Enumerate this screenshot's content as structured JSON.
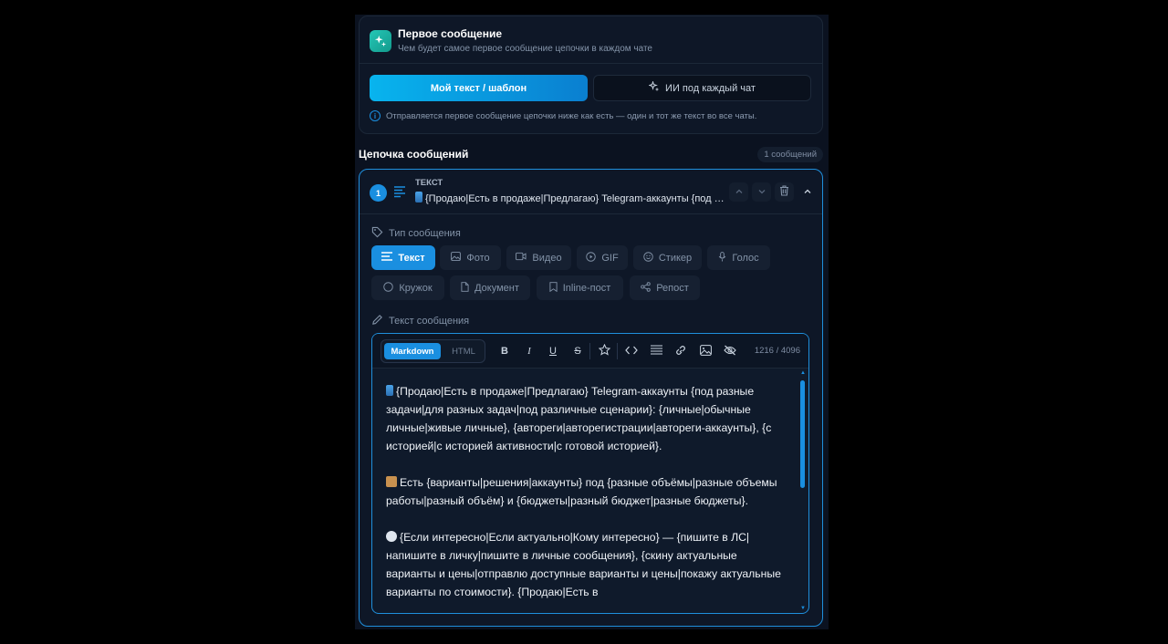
{
  "first_message": {
    "title": "Первое сообщение",
    "subtitle": "Чем будет самое первое сообщение цепочки в каждом чате",
    "mode_custom": "Мой текст / шаблон",
    "mode_ai": "ИИ под каждый чат",
    "info": "Отправляется первое сообщение цепочки ниже как есть — один и тот же текст во все чаты."
  },
  "chain": {
    "title": "Цепочка сообщений",
    "count": "1 сообщений"
  },
  "message": {
    "number": "1",
    "kind": "ТЕКСТ",
    "preview": "{Продаю|Есть в продаже|Предлагаю} Telegram-аккаунты {под разные задачи|для разных задач|под различные сценарии}: {личные|обычные личные|живые личные}",
    "type_label": "Тип сообщения",
    "types": [
      "Текст",
      "Фото",
      "Видео",
      "GIF",
      "Стикер",
      "Голос",
      "Кружок",
      "Документ",
      "Inline-пост",
      "Репост"
    ],
    "active_type": "Текст",
    "text_label": "Текст сообщения"
  },
  "editor": {
    "tab_markdown": "Markdown",
    "tab_html": "HTML",
    "counter": "1216 / 4096",
    "paragraphs": [
      "{Продаю|Есть в продаже|Предлагаю} Telegram-аккаунты {под разные задачи|для разных задач|под различные сценарии}: {личные|обычные личные|живые личные}, {автореги|авторегистрации|автореги-аккаунты}, {с историей|с историей активности|с готовой историей}.",
      "Есть {варианты|решения|аккаунты} под {разные объёмы|разные объемы работы|разный объём} и {бюджеты|разный бюджет|разные бюджеты}.",
      "{Если интересно|Если актуально|Кому интересно} — {пишите в ЛС|напишите в личку|пишите в личные сообщения}, {скину актуальные варианты и цены|отправлю доступные варианты и цены|покажу актуальные варианты по стоимости}. {Продаю|Есть в"
    ]
  },
  "colors": {
    "accent": "#1a8fe0",
    "accent_gradient_start": "#08b4ee",
    "panel_bg": "#0e1727",
    "page_bg": "#000000"
  },
  "icons": {
    "first_message": "sparkles-icon",
    "ai": "sparkles-icon",
    "info": "info-icon",
    "kind": "text-lines-icon",
    "move_up": "chevron-up-icon",
    "move_down": "chevron-down-icon",
    "delete": "trash-icon",
    "collapse": "chevron-up-icon",
    "type_label": "tag-icon",
    "text_label": "pencil-icon"
  }
}
